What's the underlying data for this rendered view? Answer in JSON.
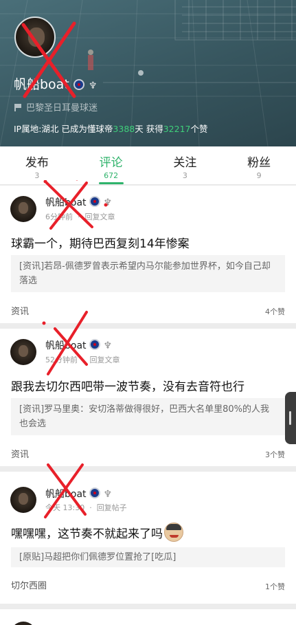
{
  "profile": {
    "username": "帆船boat",
    "club": "巴黎圣日耳曼球迷",
    "ip_line_prefix": "IP属地:湖北 已成为懂球帝",
    "days": "3388",
    "ip_line_mid": "天 获得",
    "likes_total": "32217",
    "ip_line_suffix": "个赞"
  },
  "tabs": [
    {
      "label": "发布",
      "count": "3"
    },
    {
      "label": "评论",
      "count": "672"
    },
    {
      "label": "关注",
      "count": "3"
    },
    {
      "label": "粉丝",
      "count": "9"
    }
  ],
  "comments": [
    {
      "name": "帆船boat",
      "time": "6分钟前",
      "action": "回复文章",
      "text": "球霸一个，期待巴西复刻14年惨案",
      "quote": "[资讯]若昂-佩德罗曾表示希望内马尔能参加世界杯，如今自己却落选",
      "source": "资讯",
      "likes": "4个赞"
    },
    {
      "name": "帆船boat",
      "time": "52分钟前",
      "action": "回复文章",
      "text": "跟我去切尔西吧带一波节奏，没有去音符也行",
      "quote": "[资讯]罗马里奥：安切洛蒂做得很好，巴西大名单里80%的人我也会选",
      "source": "资讯",
      "likes": "3个赞"
    },
    {
      "name": "帆船boat",
      "time": "今天 13:30",
      "action": "回复帖子",
      "text": "嘿嘿嘿，这节奏不就起来了吗",
      "quote": "[原贴]马超把你们佩德罗位置抢了[吃瓜]",
      "source": "切尔西圈",
      "likes": "1个赞"
    }
  ],
  "colors": {
    "accent": "#2fb36b",
    "header_bg": "#3e5f68",
    "redact": "#e8202a"
  },
  "icons": [
    "psg-badge-icon",
    "trophy-icon",
    "flag-icon",
    "laughing-emoji-icon"
  ]
}
